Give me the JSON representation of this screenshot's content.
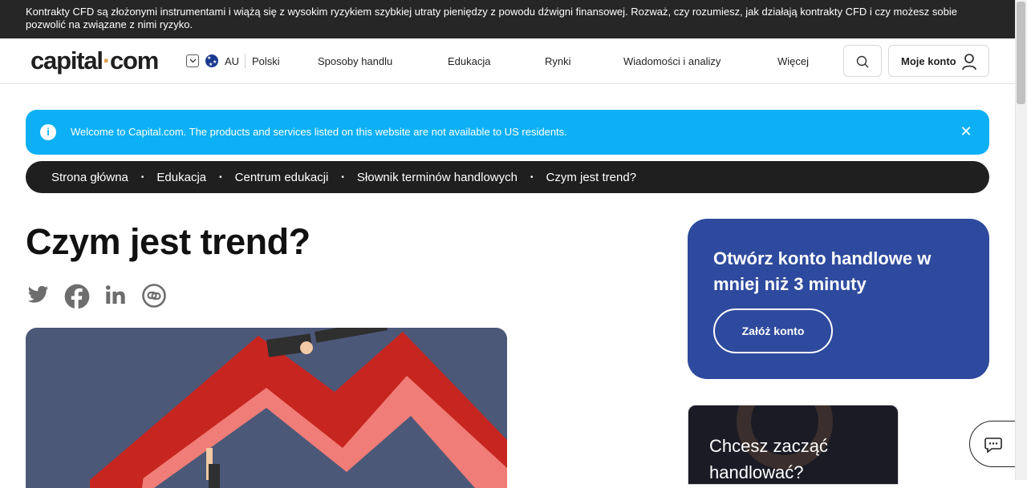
{
  "risk_warning": "Kontrakty CFD są złożonymi instrumentami i wiążą się z wysokim ryzykiem szybkiej utraty pieniędzy z powodu dźwigni finansowej. Rozważ, czy rozumiesz, jak działają kontrakty CFD i czy możesz sobie pozwolić na związane z nimi ryzyko.",
  "header": {
    "logo_left": "capital",
    "logo_dot": "·",
    "logo_right": "com",
    "region": "AU",
    "language": "Polski",
    "nav": [
      "Sposoby handlu",
      "Edukacja",
      "Rynki",
      "Wiadomości i analizy",
      "Więcej"
    ],
    "account_label": "Moje konto"
  },
  "notice": {
    "info_symbol": "i",
    "text": "Welcome to Capital.com. The products and services listed on this website are not available to US residents.",
    "close_symbol": "✕"
  },
  "breadcrumb": [
    "Strona główna",
    "Edukacja",
    "Centrum edukacji",
    "Słownik terminów handlowych",
    "Czym jest trend?"
  ],
  "breadcrumb_sep": "•",
  "article": {
    "title": "Czym jest trend?"
  },
  "share_icons": [
    "twitter-icon",
    "facebook-icon",
    "linkedin-icon",
    "copy-link-icon"
  ],
  "cta": {
    "title": "Otwórz konto handlowe w mniej niż 3 minuty",
    "button": "Załóż konto"
  },
  "promo": {
    "text": "Chcesz zacząć handlować?"
  },
  "colors": {
    "accent_blue": "#0db0f4",
    "cta_blue": "#2e4a9e",
    "dark": "#1f1f1f",
    "chart_red": "#c62828"
  }
}
